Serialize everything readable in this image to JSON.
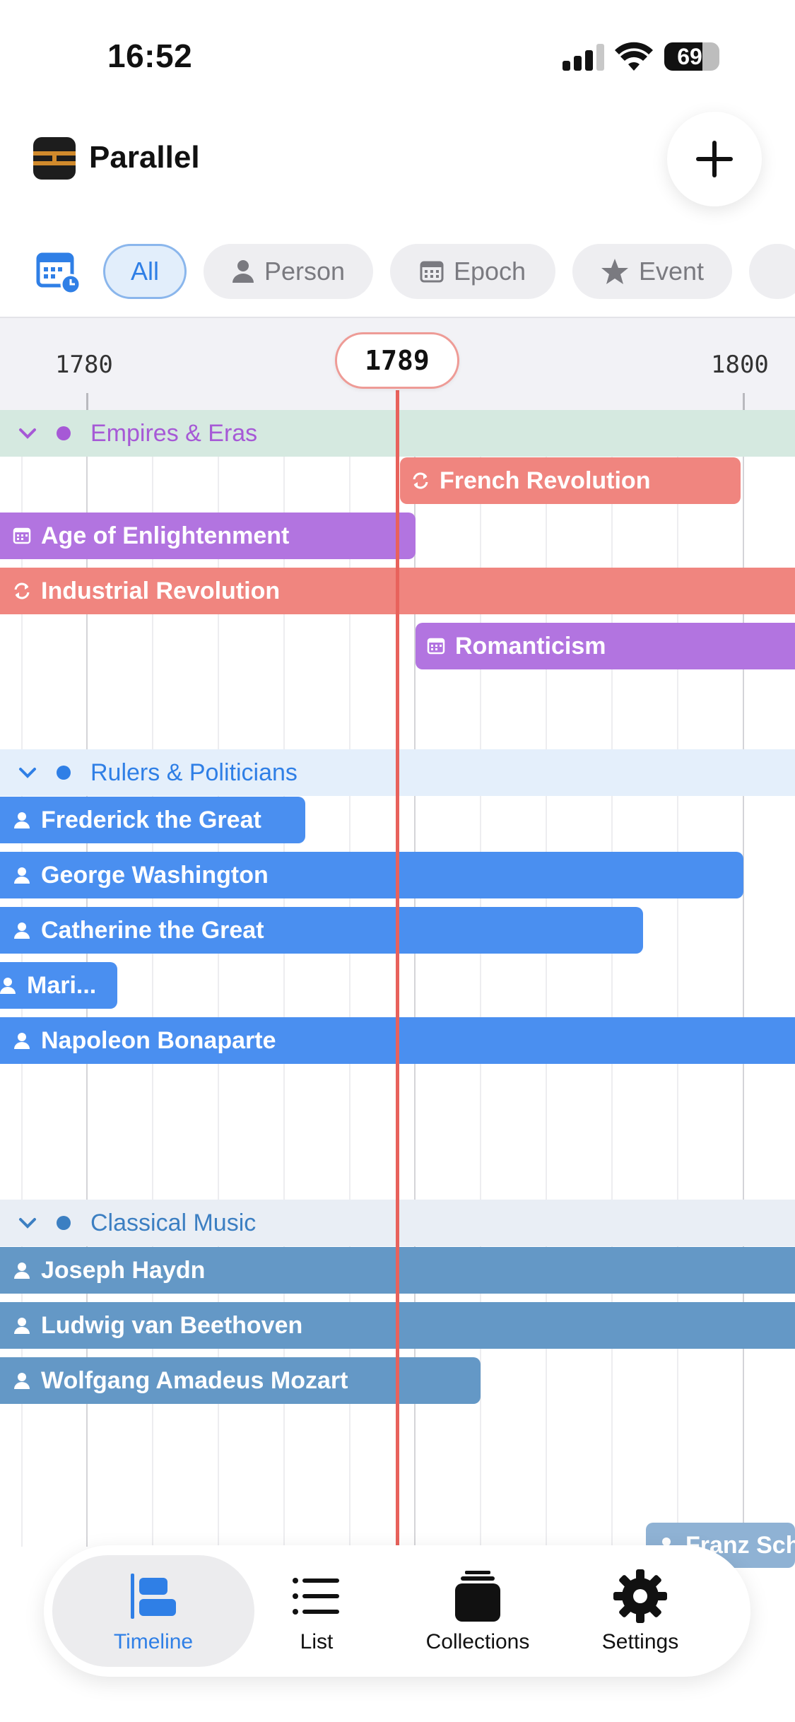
{
  "status_bar": {
    "time": "16:52",
    "battery": "69"
  },
  "header": {
    "app_name": "Parallel"
  },
  "filters": [
    {
      "label": "All",
      "active": true
    },
    {
      "label": "Person",
      "icon": "person-icon"
    },
    {
      "label": "Epoch",
      "icon": "calendar-icon"
    },
    {
      "label": "Event",
      "icon": "star-icon"
    }
  ],
  "timeline": {
    "ticks": [
      "1780",
      "1800"
    ],
    "current_year": "1789"
  },
  "groups": [
    {
      "title": "Empires & Eras",
      "color": "#a659d6",
      "bg": "#d5e9e0",
      "items": [
        {
          "label": "French Revolution",
          "type": "event",
          "color": "#f0857f"
        },
        {
          "label": "Age of Enlightenment",
          "type": "epoch",
          "color": "#b274e0"
        },
        {
          "label": "Industrial Revolution",
          "type": "event",
          "color": "#f0857f"
        },
        {
          "label": "Romanticism",
          "type": "epoch",
          "color": "#b274e0"
        }
      ]
    },
    {
      "title": "Rulers & Politicians",
      "color": "#2f7fe6",
      "bg": "#e4effb",
      "items": [
        {
          "label": "Frederick the Great",
          "type": "person",
          "color": "#4a8ff0"
        },
        {
          "label": "George Washington",
          "type": "person",
          "color": "#4a8ff0"
        },
        {
          "label": "Catherine the Great",
          "type": "person",
          "color": "#4a8ff0"
        },
        {
          "label": "Mari...",
          "type": "person",
          "color": "#4a8ff0"
        },
        {
          "label": "Napoleon Bonaparte",
          "type": "person",
          "color": "#4a8ff0"
        }
      ]
    },
    {
      "title": "Classical Music",
      "color": "#3c7fc2",
      "bg": "#e9eef5",
      "items": [
        {
          "label": "Joseph Haydn",
          "type": "person",
          "color": "#6498c6"
        },
        {
          "label": "Ludwig van Beethoven",
          "type": "person",
          "color": "#6498c6"
        },
        {
          "label": "Wolfgang Amadeus Mozart",
          "type": "person",
          "color": "#6498c6"
        },
        {
          "label": "Franz Sch",
          "type": "person",
          "color": "#8fb2d4"
        }
      ]
    }
  ],
  "tabbar": {
    "tabs": [
      {
        "label": "Timeline",
        "active": true
      },
      {
        "label": "List"
      },
      {
        "label": "Collections"
      },
      {
        "label": "Settings"
      }
    ]
  }
}
